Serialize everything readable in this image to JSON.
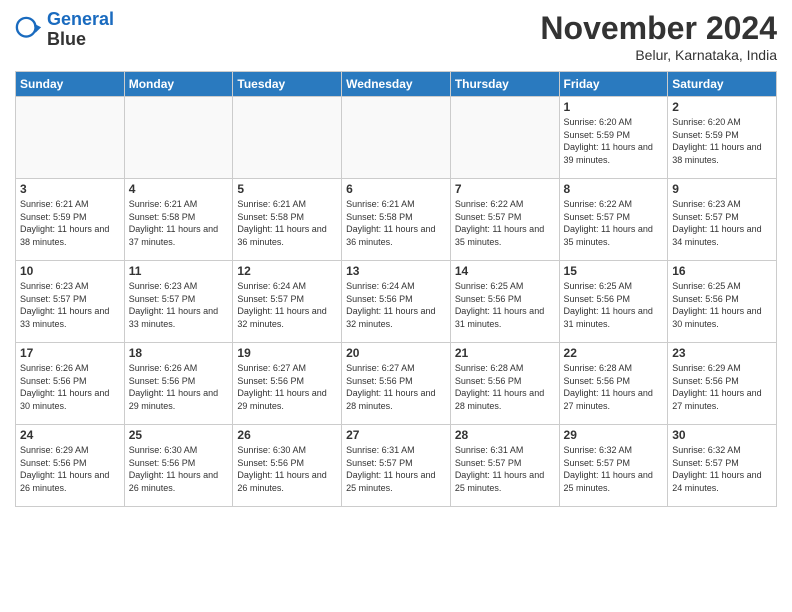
{
  "header": {
    "logo_line1": "General",
    "logo_line2": "Blue",
    "month_title": "November 2024",
    "location": "Belur, Karnataka, India"
  },
  "weekdays": [
    "Sunday",
    "Monday",
    "Tuesday",
    "Wednesday",
    "Thursday",
    "Friday",
    "Saturday"
  ],
  "weeks": [
    [
      {
        "day": "",
        "empty": true
      },
      {
        "day": "",
        "empty": true
      },
      {
        "day": "",
        "empty": true
      },
      {
        "day": "",
        "empty": true
      },
      {
        "day": "",
        "empty": true
      },
      {
        "day": "1",
        "sunrise": "Sunrise: 6:20 AM",
        "sunset": "Sunset: 5:59 PM",
        "daylight": "Daylight: 11 hours and 39 minutes."
      },
      {
        "day": "2",
        "sunrise": "Sunrise: 6:20 AM",
        "sunset": "Sunset: 5:59 PM",
        "daylight": "Daylight: 11 hours and 38 minutes."
      }
    ],
    [
      {
        "day": "3",
        "sunrise": "Sunrise: 6:21 AM",
        "sunset": "Sunset: 5:59 PM",
        "daylight": "Daylight: 11 hours and 38 minutes."
      },
      {
        "day": "4",
        "sunrise": "Sunrise: 6:21 AM",
        "sunset": "Sunset: 5:58 PM",
        "daylight": "Daylight: 11 hours and 37 minutes."
      },
      {
        "day": "5",
        "sunrise": "Sunrise: 6:21 AM",
        "sunset": "Sunset: 5:58 PM",
        "daylight": "Daylight: 11 hours and 36 minutes."
      },
      {
        "day": "6",
        "sunrise": "Sunrise: 6:21 AM",
        "sunset": "Sunset: 5:58 PM",
        "daylight": "Daylight: 11 hours and 36 minutes."
      },
      {
        "day": "7",
        "sunrise": "Sunrise: 6:22 AM",
        "sunset": "Sunset: 5:57 PM",
        "daylight": "Daylight: 11 hours and 35 minutes."
      },
      {
        "day": "8",
        "sunrise": "Sunrise: 6:22 AM",
        "sunset": "Sunset: 5:57 PM",
        "daylight": "Daylight: 11 hours and 35 minutes."
      },
      {
        "day": "9",
        "sunrise": "Sunrise: 6:23 AM",
        "sunset": "Sunset: 5:57 PM",
        "daylight": "Daylight: 11 hours and 34 minutes."
      }
    ],
    [
      {
        "day": "10",
        "sunrise": "Sunrise: 6:23 AM",
        "sunset": "Sunset: 5:57 PM",
        "daylight": "Daylight: 11 hours and 33 minutes."
      },
      {
        "day": "11",
        "sunrise": "Sunrise: 6:23 AM",
        "sunset": "Sunset: 5:57 PM",
        "daylight": "Daylight: 11 hours and 33 minutes."
      },
      {
        "day": "12",
        "sunrise": "Sunrise: 6:24 AM",
        "sunset": "Sunset: 5:57 PM",
        "daylight": "Daylight: 11 hours and 32 minutes."
      },
      {
        "day": "13",
        "sunrise": "Sunrise: 6:24 AM",
        "sunset": "Sunset: 5:56 PM",
        "daylight": "Daylight: 11 hours and 32 minutes."
      },
      {
        "day": "14",
        "sunrise": "Sunrise: 6:25 AM",
        "sunset": "Sunset: 5:56 PM",
        "daylight": "Daylight: 11 hours and 31 minutes."
      },
      {
        "day": "15",
        "sunrise": "Sunrise: 6:25 AM",
        "sunset": "Sunset: 5:56 PM",
        "daylight": "Daylight: 11 hours and 31 minutes."
      },
      {
        "day": "16",
        "sunrise": "Sunrise: 6:25 AM",
        "sunset": "Sunset: 5:56 PM",
        "daylight": "Daylight: 11 hours and 30 minutes."
      }
    ],
    [
      {
        "day": "17",
        "sunrise": "Sunrise: 6:26 AM",
        "sunset": "Sunset: 5:56 PM",
        "daylight": "Daylight: 11 hours and 30 minutes."
      },
      {
        "day": "18",
        "sunrise": "Sunrise: 6:26 AM",
        "sunset": "Sunset: 5:56 PM",
        "daylight": "Daylight: 11 hours and 29 minutes."
      },
      {
        "day": "19",
        "sunrise": "Sunrise: 6:27 AM",
        "sunset": "Sunset: 5:56 PM",
        "daylight": "Daylight: 11 hours and 29 minutes."
      },
      {
        "day": "20",
        "sunrise": "Sunrise: 6:27 AM",
        "sunset": "Sunset: 5:56 PM",
        "daylight": "Daylight: 11 hours and 28 minutes."
      },
      {
        "day": "21",
        "sunrise": "Sunrise: 6:28 AM",
        "sunset": "Sunset: 5:56 PM",
        "daylight": "Daylight: 11 hours and 28 minutes."
      },
      {
        "day": "22",
        "sunrise": "Sunrise: 6:28 AM",
        "sunset": "Sunset: 5:56 PM",
        "daylight": "Daylight: 11 hours and 27 minutes."
      },
      {
        "day": "23",
        "sunrise": "Sunrise: 6:29 AM",
        "sunset": "Sunset: 5:56 PM",
        "daylight": "Daylight: 11 hours and 27 minutes."
      }
    ],
    [
      {
        "day": "24",
        "sunrise": "Sunrise: 6:29 AM",
        "sunset": "Sunset: 5:56 PM",
        "daylight": "Daylight: 11 hours and 26 minutes."
      },
      {
        "day": "25",
        "sunrise": "Sunrise: 6:30 AM",
        "sunset": "Sunset: 5:56 PM",
        "daylight": "Daylight: 11 hours and 26 minutes."
      },
      {
        "day": "26",
        "sunrise": "Sunrise: 6:30 AM",
        "sunset": "Sunset: 5:56 PM",
        "daylight": "Daylight: 11 hours and 26 minutes."
      },
      {
        "day": "27",
        "sunrise": "Sunrise: 6:31 AM",
        "sunset": "Sunset: 5:57 PM",
        "daylight": "Daylight: 11 hours and 25 minutes."
      },
      {
        "day": "28",
        "sunrise": "Sunrise: 6:31 AM",
        "sunset": "Sunset: 5:57 PM",
        "daylight": "Daylight: 11 hours and 25 minutes."
      },
      {
        "day": "29",
        "sunrise": "Sunrise: 6:32 AM",
        "sunset": "Sunset: 5:57 PM",
        "daylight": "Daylight: 11 hours and 25 minutes."
      },
      {
        "day": "30",
        "sunrise": "Sunrise: 6:32 AM",
        "sunset": "Sunset: 5:57 PM",
        "daylight": "Daylight: 11 hours and 24 minutes."
      }
    ]
  ]
}
